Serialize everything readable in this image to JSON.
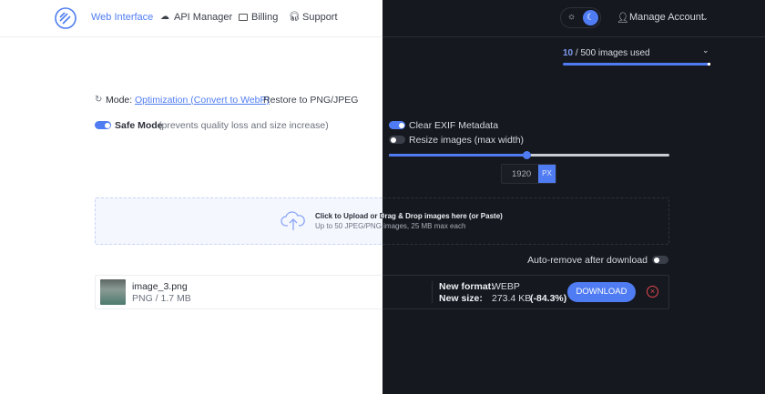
{
  "header": {
    "nav": [
      {
        "label": "Web Interface",
        "icon": "logo-icon",
        "active": true
      },
      {
        "label": "API Manager",
        "icon": "cloud-icon"
      },
      {
        "label": "Billing",
        "icon": "card-icon"
      },
      {
        "label": "Support",
        "icon": "headset-icon"
      }
    ],
    "theme": "dark",
    "account_label": "Manage Account"
  },
  "usage": {
    "used": "10",
    "rest": " / 500 images used"
  },
  "mode": {
    "label": "Mode:",
    "active_option": "Optimization (Convert to WebP)",
    "other_option": "Restore to PNG/JPEG"
  },
  "safe_mode": {
    "label": "Safe Mode",
    "hint": "(prevents quality loss and size increase)",
    "on": true
  },
  "options": {
    "clear_exif": {
      "label": "Clear EXIF Metadata",
      "on": true
    },
    "resize": {
      "label": "Resize images (max width)",
      "on": false
    },
    "slider_fraction": 0.49,
    "width_value": "1920",
    "unit": "PX"
  },
  "upload": {
    "title": "Click to Upload or Drag & Drop images here (or Paste)",
    "subtitle": "Up to 50 JPEG/PNG images, 25 MB max each"
  },
  "auto_remove": {
    "label": "Auto-remove after download",
    "on": false
  },
  "files": [
    {
      "name": "image_3.png",
      "meta": "PNG / 1.7 MB",
      "format_label": "New format:",
      "format": "WEBP",
      "size_label": "New size:",
      "size": "273.4 KB",
      "reduction": "(-84.3%)",
      "download_label": "DOWNLOAD"
    }
  ],
  "colors": {
    "accent": "#4f7cf3",
    "dark_bg": "#15181f",
    "danger": "#e5484d"
  }
}
